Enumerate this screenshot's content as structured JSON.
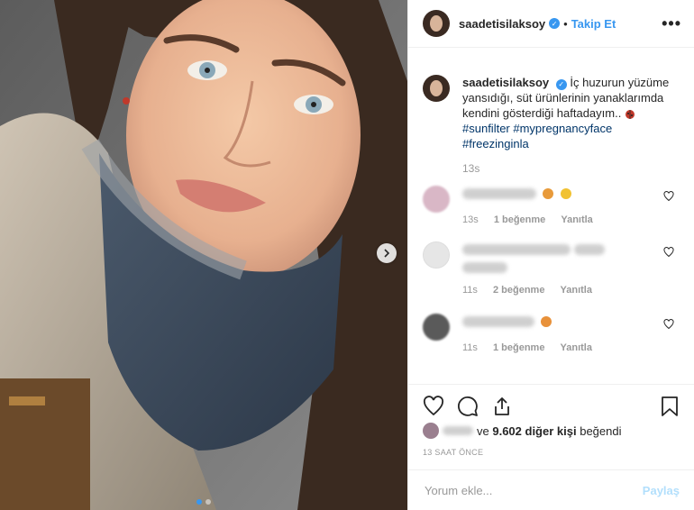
{
  "header": {
    "username": "saadetisilaksoy",
    "separator": "•",
    "follow_label": "Takip Et",
    "more_label": "•••"
  },
  "caption": {
    "username": "saadetisilaksoy",
    "text": "İç huzurun yüzüme yansıdığı, süt ürünlerinin yanaklarımda kendini gösterdiği haftadayım..",
    "hashtags": [
      "#sunfilter",
      "#mypregnancyface",
      "#freezinginla"
    ],
    "time": "13s"
  },
  "comments": [
    {
      "time": "13s",
      "likes": "1 beğenme",
      "reply": "Yanıtla"
    },
    {
      "time": "11s",
      "likes": "2 beğenme",
      "reply": "Yanıtla"
    },
    {
      "time": "11s",
      "likes": "1 beğenme",
      "reply": "Yanıtla"
    }
  ],
  "likes": {
    "middle": "ve",
    "count_text": "9.602 diğer kişi",
    "suffix": "beğendi"
  },
  "timestamp": "13 SAAT ÖNCE",
  "add_comment": {
    "placeholder": "Yorum ekle...",
    "post_label": "Paylaş"
  },
  "icons": [
    "heart-icon",
    "comment-icon",
    "share-icon",
    "bookmark-icon",
    "verified-icon",
    "chevron-right-icon",
    "ladybug-icon"
  ],
  "colors": {
    "accent": "#3897f0",
    "hashtag": "#003569",
    "muted": "#999999"
  }
}
